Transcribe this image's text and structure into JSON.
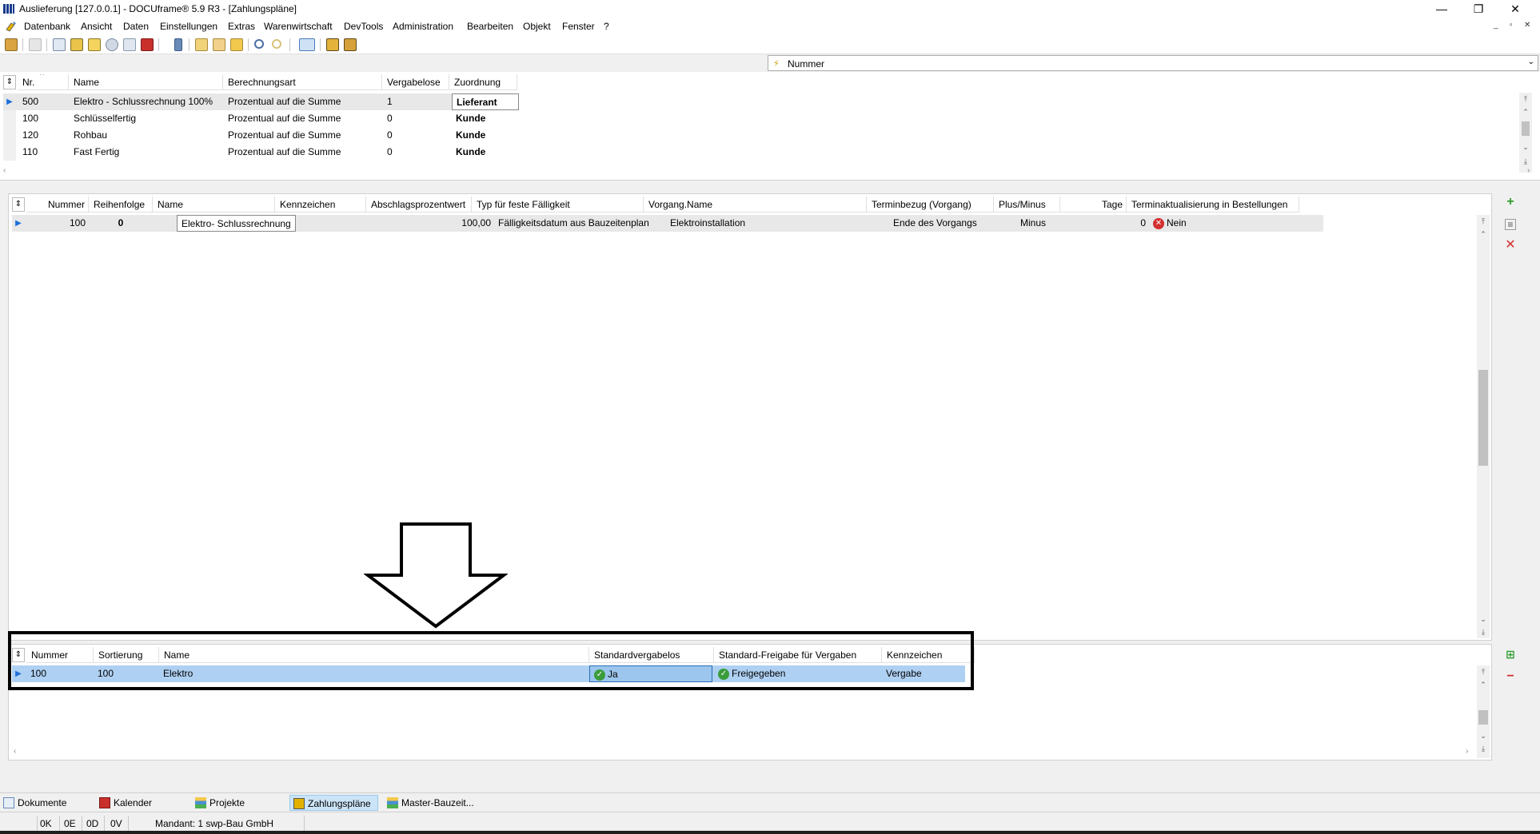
{
  "window": {
    "title": "Auslieferung [127.0.0.1] - DOCUframe® 5.9 R3 - [Zahlungspläne]",
    "minimize": "—",
    "restore": "❐",
    "close": "✕"
  },
  "menu": {
    "items": [
      "Datenbank",
      "Ansicht",
      "Daten",
      "Einstellungen",
      "Extras",
      "Warenwirtschaft",
      "DevTools",
      "Administration",
      "Bearbeiten",
      "Objekt",
      "Fenster",
      "?"
    ],
    "mdi_minimize": "_",
    "mdi_restore": "▫",
    "mdi_close": "✕"
  },
  "sort_combo": {
    "label": "Nummer",
    "icon": "lightning-icon",
    "dropdown": "⌄"
  },
  "plans_grid": {
    "columns": [
      "Nr.",
      "Name",
      "Berechnungsart",
      "Vergabelose",
      "Zuordnung"
    ],
    "sort_indicator": "^",
    "rows": [
      {
        "nr": "500",
        "name": "Elektro - Schlussrechnung 100%",
        "art": "Prozentual auf die Summe",
        "lose": "1",
        "zuordnung": "Lieferant"
      },
      {
        "nr": "100",
        "name": "Schlüsselfertig",
        "art": "Prozentual auf die Summe",
        "lose": "0",
        "zuordnung": "Kunde"
      },
      {
        "nr": "120",
        "name": "Rohbau",
        "art": "Prozentual auf die Summe",
        "lose": "0",
        "zuordnung": "Kunde"
      },
      {
        "nr": "110",
        "name": "Fast Fertig",
        "art": "Prozentual auf die Summe",
        "lose": "0",
        "zuordnung": "Kunde"
      }
    ]
  },
  "steps_grid": {
    "columns": [
      "Nummer",
      "Reihenfolge",
      "Name",
      "Kennzeichen",
      "Abschlagsprozentwert",
      "Typ für feste Fälligkeit",
      "Vorgang.Name",
      "Terminbezug (Vorgang)",
      "Plus/Minus",
      "Tage",
      "Terminaktualisierung in Bestellungen"
    ],
    "rows": [
      {
        "nummer": "100",
        "reihenfolge": "0",
        "name": "Elektro- Schlussrechnung",
        "kennzeichen": "",
        "prozent": "100,00",
        "typ": "Fälligkeitsdatum aus Bauzeitenplan",
        "vorgang": "Elektroinstallation",
        "terminbezug": "Ende des Vorgangs",
        "plusminus": "Minus",
        "tage": "0",
        "aktualisierung": "Nein"
      }
    ]
  },
  "lots_grid": {
    "columns": [
      "Nummer",
      "Sortierung",
      "Name",
      "Standardvergabelos",
      "Standard-Freigabe für Vergaben",
      "Kennzeichen"
    ],
    "rows": [
      {
        "nummer": "100",
        "sortierung": "100",
        "name": "Elektro",
        "standard": "Ja",
        "freigabe": "Freigegeben",
        "kennzeichen": "Vergabe"
      }
    ]
  },
  "tabs": [
    {
      "label": "Dokumente",
      "icon": "documents-icon"
    },
    {
      "label": "Kalender",
      "icon": "calendar-icon"
    },
    {
      "label": "Projekte",
      "icon": "projects-icon"
    },
    {
      "label": "Zahlungspläne",
      "icon": "payment-plan-icon",
      "active": true
    },
    {
      "label": "Master-Bauzeit...",
      "icon": "master-schedule-icon"
    }
  ],
  "status": {
    "k": "0K",
    "e": "0E",
    "d": "0D",
    "v": "0V",
    "mandant": "Mandant: 1 swp-Bau GmbH"
  },
  "colors": {
    "selection": "#aed0f2",
    "accent": "#1e6fd9",
    "highlight_frame": "#000000"
  }
}
